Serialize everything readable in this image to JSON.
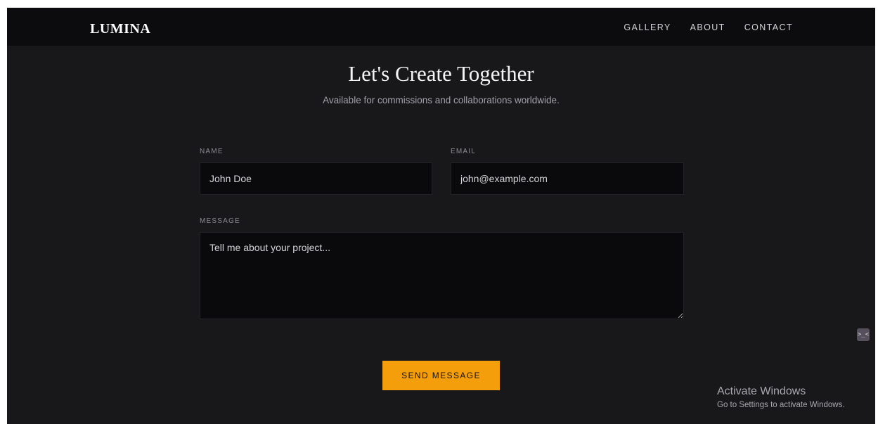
{
  "brand": {
    "logo": "LUMINA"
  },
  "nav": {
    "items": [
      {
        "label": "GALLERY"
      },
      {
        "label": "ABOUT"
      },
      {
        "label": "CONTACT"
      }
    ]
  },
  "hero": {
    "title": "Let's Create Together",
    "subtitle": "Available for commissions and collaborations worldwide."
  },
  "form": {
    "name": {
      "label": "NAME",
      "placeholder": "John Doe"
    },
    "email": {
      "label": "EMAIL",
      "placeholder": "john@example.com"
    },
    "message": {
      "label": "MESSAGE",
      "placeholder": "Tell me about your project..."
    },
    "submit_label": "SEND MESSAGE"
  },
  "side_widget": {
    "icon": "terminal-icon",
    "glyph": ">_<"
  },
  "windows_watermark": {
    "title": "Activate Windows",
    "subtitle": "Go to Settings to activate Windows."
  },
  "colors": {
    "background": "#18181b",
    "navbar": "#0c0c0e",
    "field_background": "#0a0a0c",
    "accent": "#f59e0b"
  }
}
